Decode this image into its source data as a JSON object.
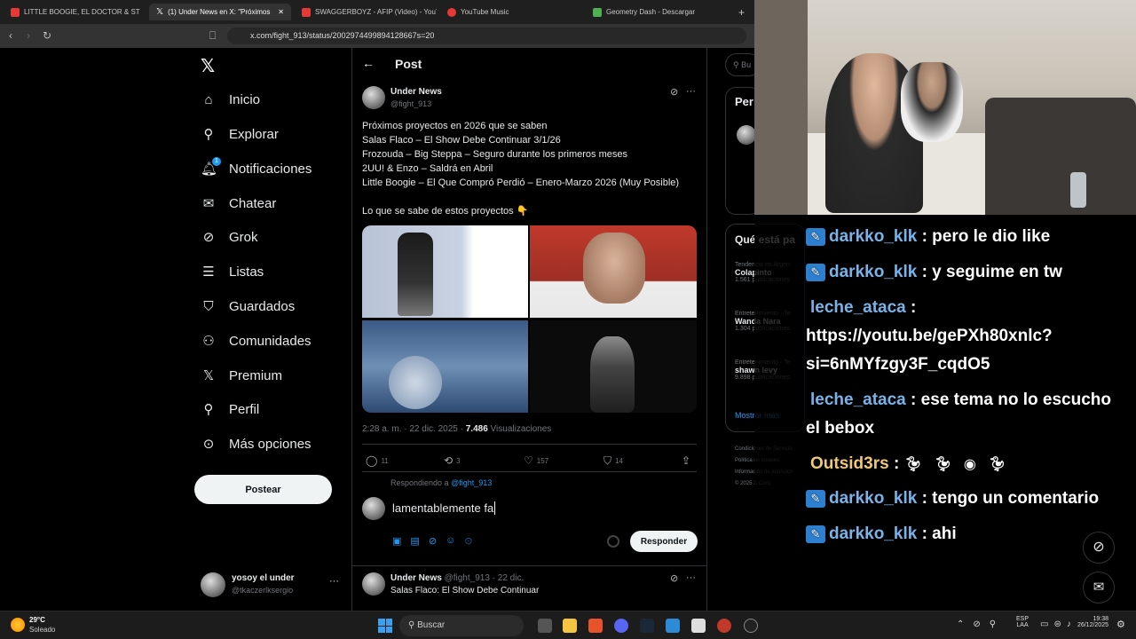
{
  "browser": {
    "tabs": [
      {
        "label": "LITTLE BOOGIE, EL DOCTOR & ST",
        "color": "#e53935"
      },
      {
        "label": "(1) Under News en X: \"Próximos",
        "color": "#ffffff"
      },
      {
        "label": "SWAGGERBOYZ - AFIP (Video) - YouT",
        "color": "#e53935"
      },
      {
        "label": "YouTube Music",
        "color": "#e53935"
      },
      {
        "label": "Geometry Dash - Descargar",
        "color": "#4caf50"
      }
    ],
    "new_tab": "+",
    "url": "x.com/fight_913/status/20029744998941286​67s=20"
  },
  "nav": {
    "items": [
      {
        "label": "Inicio",
        "icon": "home-icon"
      },
      {
        "label": "Explorar",
        "icon": "search-icon"
      },
      {
        "label": "Notificaciones",
        "icon": "bell-icon",
        "badge": "1"
      },
      {
        "label": "Chatear",
        "icon": "mail-icon"
      },
      {
        "label": "Grok",
        "icon": "grok-icon"
      },
      {
        "label": "Listas",
        "icon": "list-icon"
      },
      {
        "label": "Guardados",
        "icon": "bookmark-icon"
      },
      {
        "label": "Comunidades",
        "icon": "community-icon"
      },
      {
        "label": "Premium",
        "icon": "x-icon"
      },
      {
        "label": "Perfil",
        "icon": "person-icon"
      },
      {
        "label": "Más opciones",
        "icon": "more-icon"
      }
    ],
    "post_button": "Postear",
    "account": {
      "name": "yosoy el under",
      "handle": "@tkaczerlksergio"
    }
  },
  "main": {
    "header_title": "Post",
    "tweet": {
      "author": "Under News",
      "handle": "@fight_913",
      "lines": [
        "Próximos proyectos en 2026 que se saben",
        "Salas Flaco – El Show Debe Continuar 3/1/26",
        "Frozouda – Big Steppa – Seguro durante los primeros meses",
        "2UU! & Enzo – Saldrá en Abril",
        "Little Boogie – El Que Compró Perdió – Enero-Marzo 2026 (Muy Posible)",
        "",
        "Lo que se sabe de estos proyectos 👇"
      ],
      "time": "2:28 a. m. · 22 dic. 2025 ·",
      "views_count": "7.486",
      "views_label": "Visualizaciones",
      "replies": "11",
      "reposts": "3",
      "likes": "157",
      "bookmarks": "14"
    },
    "reply": {
      "replying_to_label": "Respondiendo a",
      "replying_to_handle": "@fight_913",
      "text": "lamentablemente fa",
      "button": "Responder"
    },
    "next_tweet": {
      "author": "Under News",
      "meta": "@fight_913 · 22 dic.",
      "text": "Salas Flaco: El Show Debe Continuar"
    }
  },
  "right": {
    "search_placeholder": "Bu",
    "box_title": "Per",
    "trends_title": "Qué está pa",
    "trends": [
      {
        "category": "Tendencia en Argen",
        "name": "Colapinto",
        "count": "1.561 publicaciones"
      },
      {
        "category": "Entretenimiento · Te",
        "name": "Wanda Nara",
        "count": "1.304 publicaciones"
      },
      {
        "category": "Entretenimiento · Te",
        "name": "shawn levy",
        "count": "9.898 publicaciones"
      }
    ],
    "show_more": "Mostrar más",
    "footer": [
      "Condiciones de Servicio",
      "Política de Privacidad",
      "Política de cookies",
      "Información de anuncios",
      "Más opciones ...",
      "© 2025 X Corp."
    ]
  },
  "chat": [
    {
      "user": "darkko_klk",
      "msg": ": pero le dio like",
      "badge": true
    },
    {
      "user": "darkko_klk",
      "msg": ": y seguime en tw",
      "badge": true
    },
    {
      "user": "leche_ataca",
      "msg": ":",
      "badge": false
    },
    {
      "user": "",
      "msg": "https://youtu.be/gePXh80xnlc?",
      "badge": false
    },
    {
      "user": "",
      "msg": "si=6nMYfzgy3F_cqdO5",
      "badge": false
    },
    {
      "user": "leche_ataca",
      "msg": ": ese tema no lo escucho",
      "badge": false
    },
    {
      "user": "",
      "msg": "el bebox",
      "badge": false
    },
    {
      "user": "Outsid3rs",
      "msg": ":",
      "badge": false
    },
    {
      "user": "darkko_klk",
      "msg": ": tengo un comentario",
      "badge": true
    },
    {
      "user": "darkko_klk",
      "msg": ": ahi",
      "badge": true
    }
  ],
  "taskbar": {
    "weather_temp": "29°C",
    "weather_desc": "Soleado",
    "search": "Buscar",
    "lang1": "ESP",
    "lang2": "LAA",
    "time": "19:38",
    "date": "26/12/2025"
  }
}
